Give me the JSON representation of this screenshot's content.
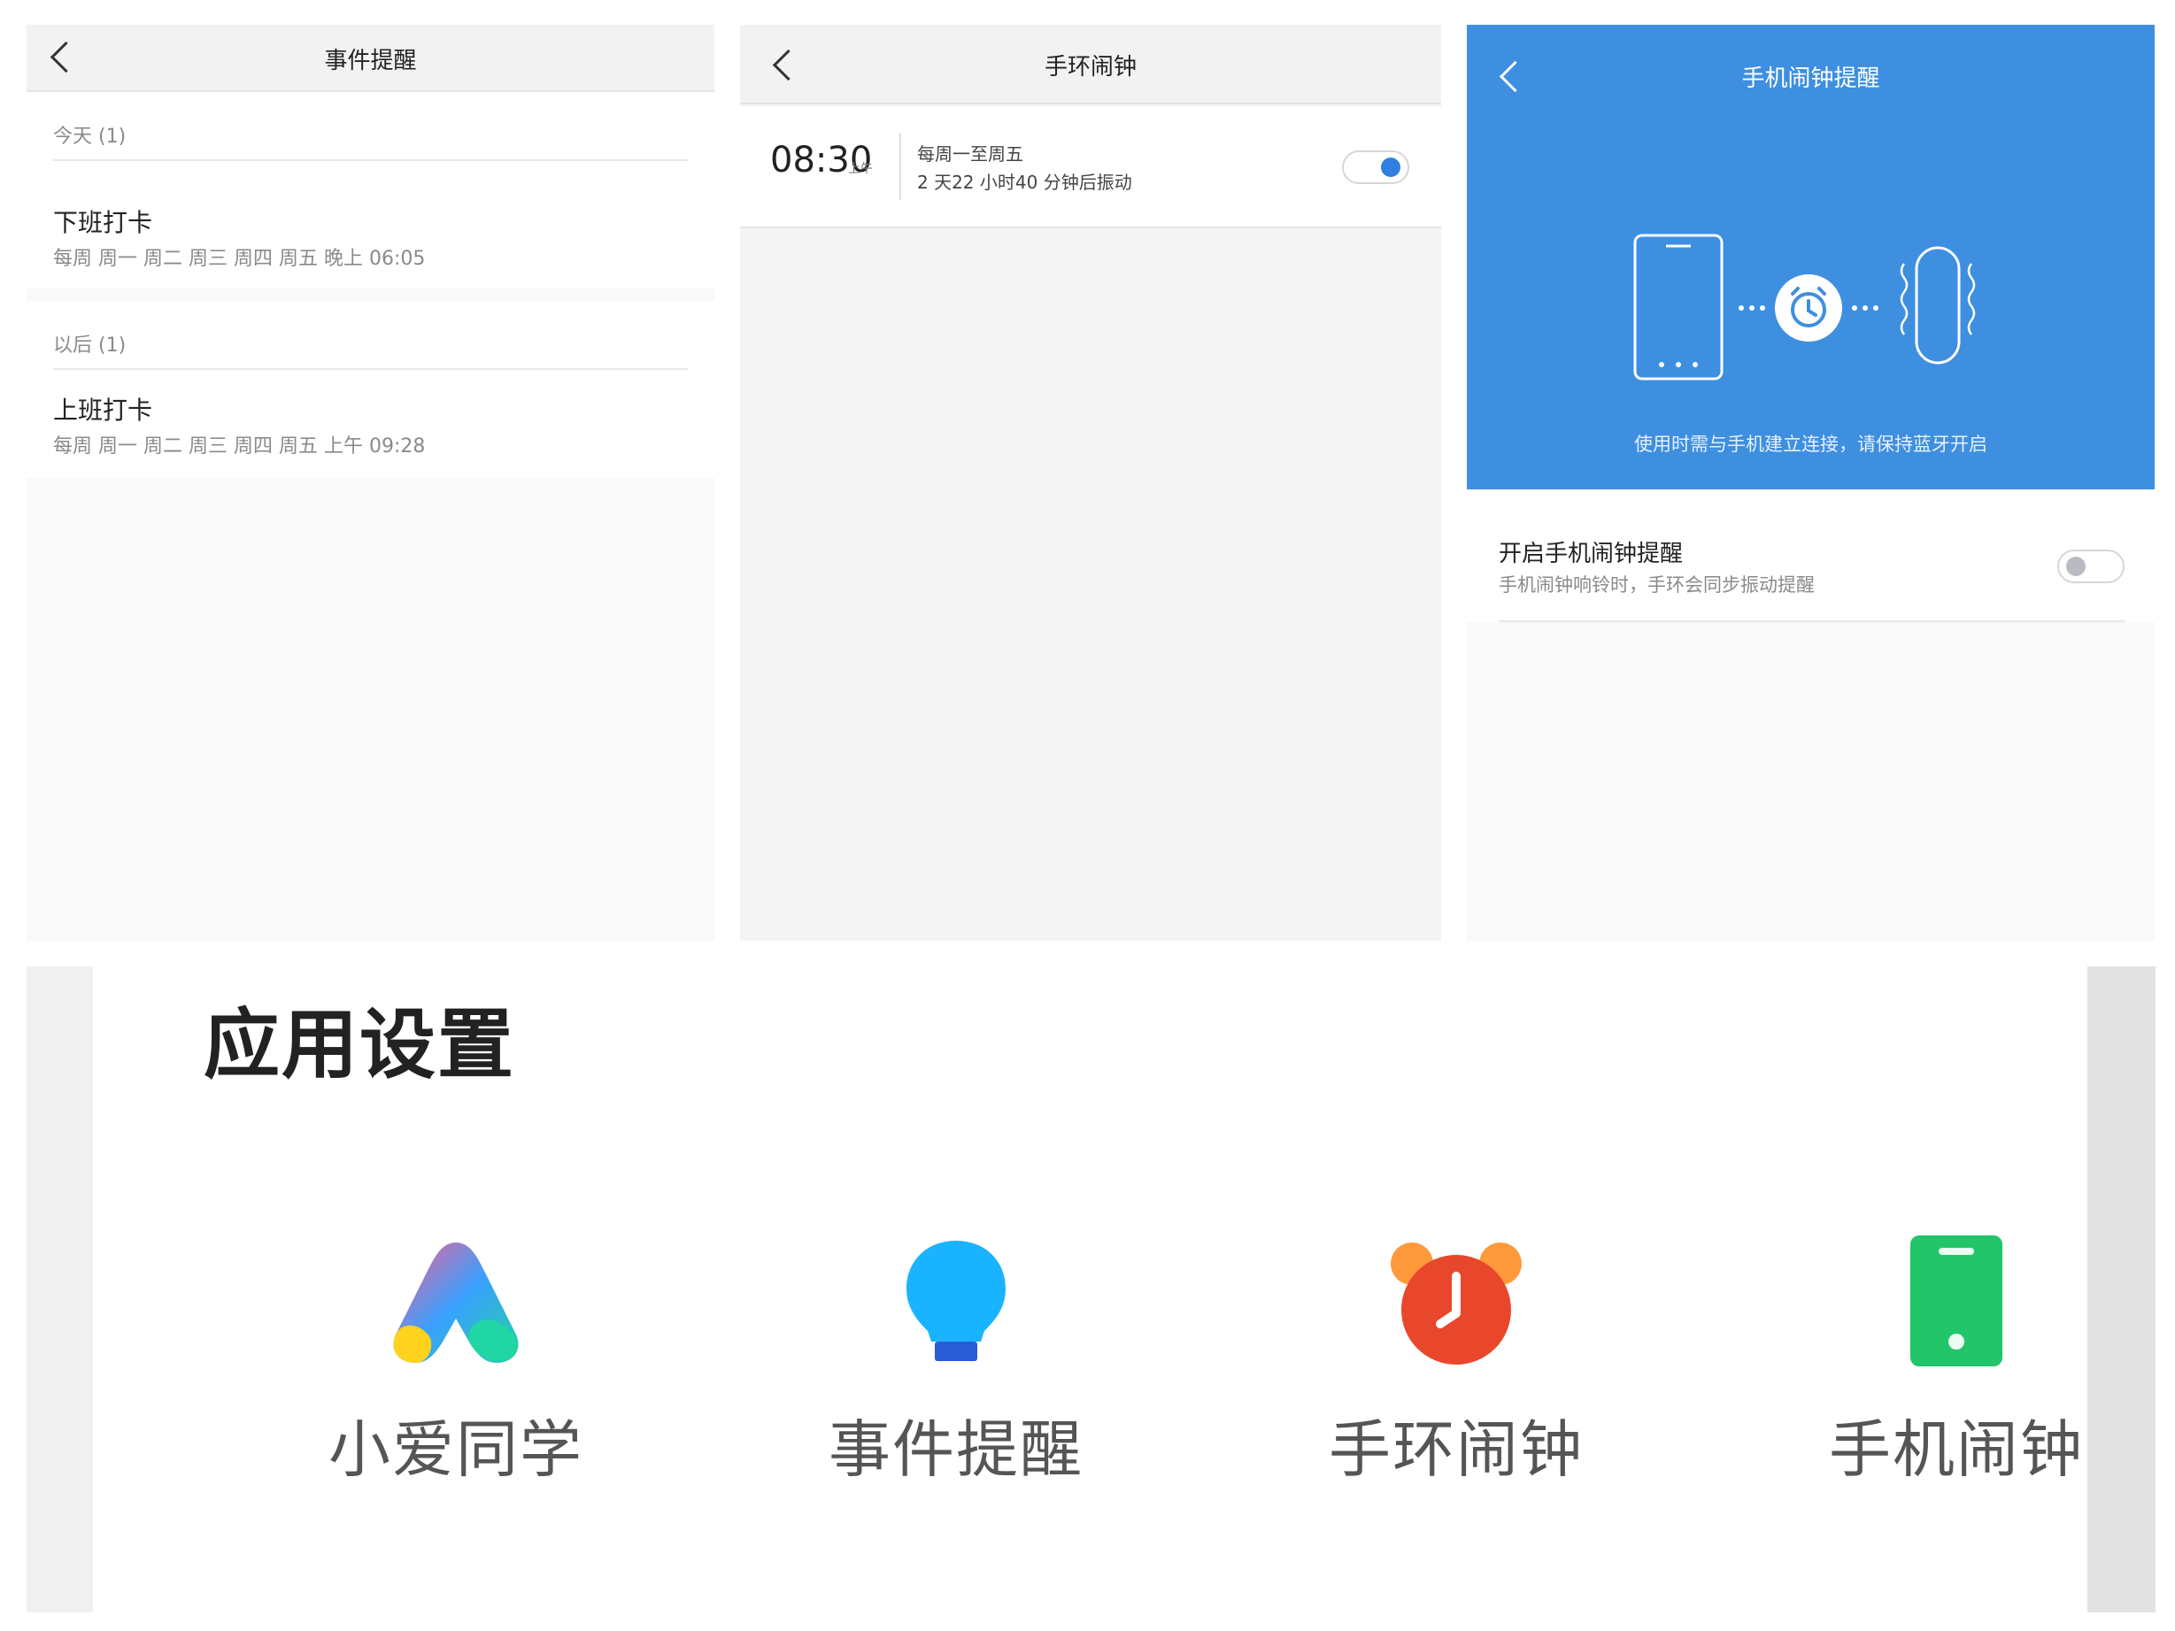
{
  "panels": {
    "event_reminder": {
      "title": "事件提醒",
      "sections": [
        {
          "header": "今天 (1)",
          "item_title": "下班打卡",
          "item_sub": "每周 周一 周二 周三 周四 周五 晚上 06:05"
        },
        {
          "header": "以后 (1)",
          "item_title": "上班打卡",
          "item_sub": "每周 周一 周二 周三 周四 周五 上午 09:28"
        }
      ]
    },
    "band_alarm": {
      "title": "手环闹钟",
      "alarm": {
        "time": "08:30",
        "ampm": "上午",
        "repeat": "每周一至周五",
        "countdown": "2 天22 小时40 分钟后振动",
        "enabled": true
      }
    },
    "phone_alarm": {
      "title": "手机闹钟提醒",
      "caption": "使用时需与手机建立连接，请保持蓝牙开启",
      "setting_title": "开启手机闹钟提醒",
      "setting_sub": "手机闹钟响铃时，手环会同步振动提醒",
      "enabled": false
    },
    "app_settings": {
      "title": "应用设置",
      "apps": [
        {
          "label": "小爱同学",
          "icon": "xiaoai-icon"
        },
        {
          "label": "事件提醒",
          "icon": "lightbulb-icon"
        },
        {
          "label": "手环闹钟",
          "icon": "alarm-clock-icon"
        },
        {
          "label": "手机闹钟",
          "icon": "phone-icon"
        }
      ]
    }
  },
  "colors": {
    "accent_blue": "#3e8fe0",
    "toggle_on": "#2f7fe0",
    "toggle_off": "#b8bcc2",
    "alarm_orange": "#e8472b",
    "phone_green": "#22c56a",
    "bulb_blue": "#1ab3ff"
  }
}
